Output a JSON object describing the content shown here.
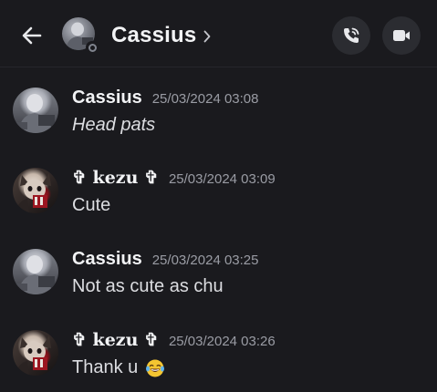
{
  "header": {
    "contact_name": "Cassius",
    "chevron_glyph": "›",
    "back_icon": "arrow-left-icon",
    "call_icon": "phone-call-icon",
    "video_icon": "video-camera-icon",
    "status": "offline"
  },
  "messages": [
    {
      "author": "Cassius",
      "timestamp": "25/03/2024 03:08",
      "text": "Head pats",
      "italic": true,
      "avatar": "cassius"
    },
    {
      "author": "✞ kezu ✞",
      "timestamp": "25/03/2024 03:09",
      "text": "Cute",
      "italic": false,
      "avatar": "kezu"
    },
    {
      "author": "Cassius",
      "timestamp": "25/03/2024 03:25",
      "text": "Not as cute as chu",
      "italic": false,
      "avatar": "cassius"
    },
    {
      "author": "✞ kezu ✞",
      "timestamp": "25/03/2024 03:26",
      "text": "Thank u",
      "italic": false,
      "avatar": "kezu",
      "emoji": "laughing-tears-emoji"
    }
  ],
  "colors": {
    "background": "#1a1a1e",
    "text_primary": "#f2f3f5",
    "text_secondary": "#9a9ca4",
    "button_bg": "#2b2c31"
  }
}
